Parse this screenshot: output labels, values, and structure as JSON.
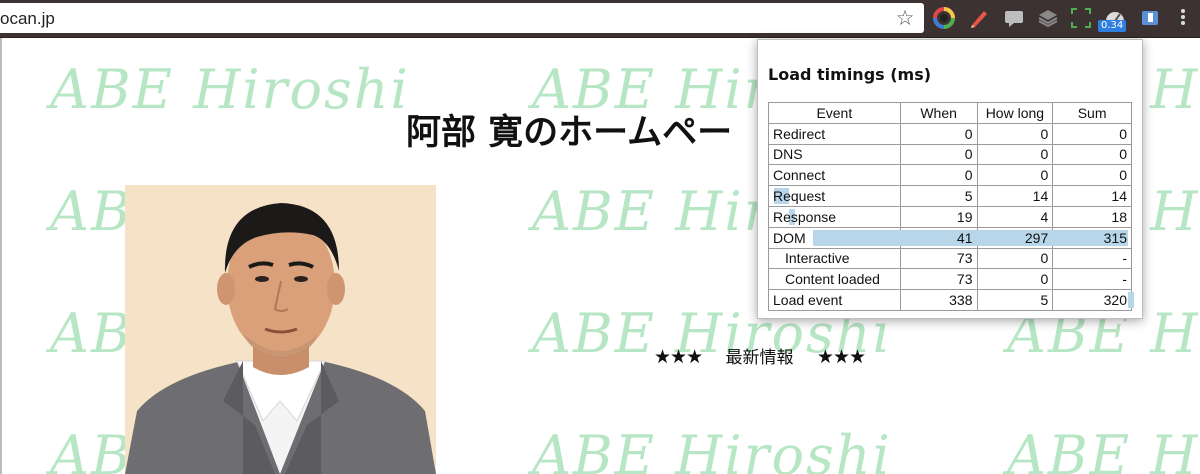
{
  "browser": {
    "url": "ocan.jp",
    "badge": "0.34",
    "extensions": [
      "color-wheel-icon",
      "pen-icon",
      "chat-icon",
      "layers-icon",
      "screenshot-icon",
      "page-load-timer-icon",
      "bookmark-icon"
    ]
  },
  "page": {
    "watermark": "ABE Hiroshi",
    "title": "阿部 寛のホームペー",
    "news_stars_left": "★★★",
    "news_label": "最新情報",
    "news_stars_right": "★★★"
  },
  "popup": {
    "title": "Load timings (ms)",
    "columns": [
      "Event",
      "When",
      "How long",
      "Sum"
    ],
    "rows": [
      {
        "event": "Redirect",
        "when": "0",
        "how_long": "0",
        "sum": "0"
      },
      {
        "event": "DNS",
        "when": "0",
        "how_long": "0",
        "sum": "0"
      },
      {
        "event": "Connect",
        "when": "0",
        "how_long": "0",
        "sum": "0"
      },
      {
        "event": "Request",
        "when": "5",
        "how_long": "14",
        "sum": "14"
      },
      {
        "event": "Response",
        "when": "19",
        "how_long": "4",
        "sum": "18"
      },
      {
        "event": "DOM",
        "when": "41",
        "how_long": "297",
        "sum": "315"
      },
      {
        "event": "Interactive",
        "when": "73",
        "how_long": "0",
        "sum": "-"
      },
      {
        "event": "Content loaded",
        "when": "73",
        "how_long": "0",
        "sum": "-"
      },
      {
        "event": "Load event",
        "when": "338",
        "how_long": "5",
        "sum": "320"
      }
    ]
  },
  "colors": {
    "toolbar": "#3d3232",
    "watermark": "#b6e6c4",
    "timing_bar": "#b7d6ea",
    "badge": "#2f7fe0"
  }
}
